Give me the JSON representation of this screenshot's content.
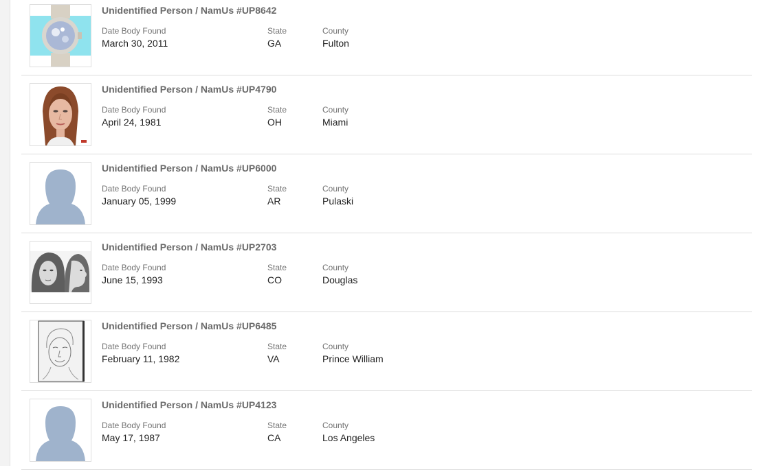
{
  "labels": {
    "date": "Date Body Found",
    "state": "State",
    "county": "County"
  },
  "cases": [
    {
      "title": "Unidentified Person / NamUs #UP8642",
      "date": "March 30, 2011",
      "state": "GA",
      "county": "Fulton",
      "image": "wristwatch-photo"
    },
    {
      "title": "Unidentified Person / NamUs #UP4790",
      "date": "April 24, 1981",
      "state": "OH",
      "county": "Miami",
      "image": "facial-reconstruction-photo"
    },
    {
      "title": "Unidentified Person / NamUs #UP6000",
      "date": "January 05, 1999",
      "state": "AR",
      "county": "Pulaski",
      "image": "silhouette-placeholder"
    },
    {
      "title": "Unidentified Person / NamUs #UP2703",
      "date": "June 15, 1993",
      "state": "CO",
      "county": "Douglas",
      "image": "front-profile-sketch"
    },
    {
      "title": "Unidentified Person / NamUs #UP6485",
      "date": "February 11, 1982",
      "state": "VA",
      "county": "Prince William",
      "image": "pencil-sketch"
    },
    {
      "title": "Unidentified Person / NamUs #UP4123",
      "date": "May 17, 1987",
      "state": "CA",
      "county": "Los Angeles",
      "image": "silhouette-placeholder"
    }
  ],
  "colors": {
    "silhouette": "#9fb3cc",
    "divider": "#dcdcdc",
    "title": "#6b6b6b"
  }
}
